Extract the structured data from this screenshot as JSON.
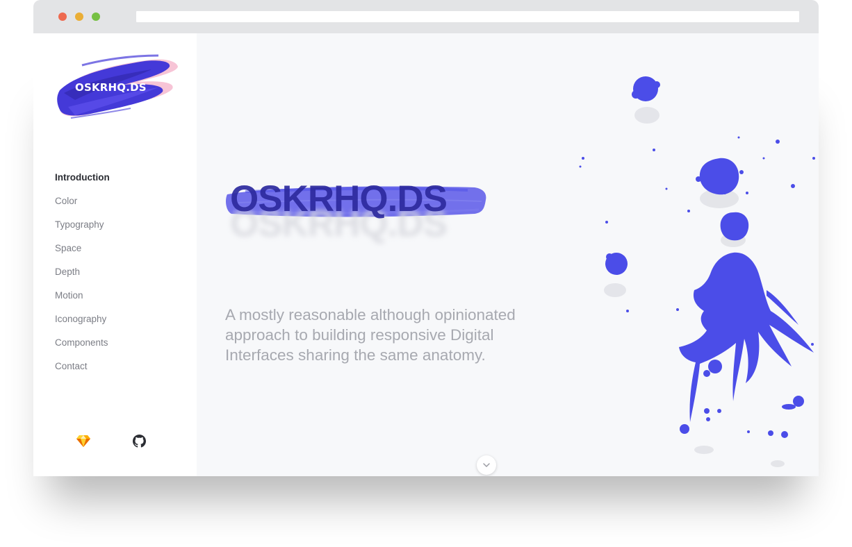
{
  "window": {
    "traffic_lights": [
      "close",
      "minimize",
      "zoom"
    ],
    "colors": {
      "close": "#ee6a50",
      "minimize": "#eaae36",
      "zoom": "#76c043"
    }
  },
  "sidebar": {
    "logo_text": "OSKRHQ.DS",
    "nav_items": [
      {
        "label": "Introduction",
        "active": true
      },
      {
        "label": "Color",
        "active": false
      },
      {
        "label": "Typography",
        "active": false
      },
      {
        "label": "Space",
        "active": false
      },
      {
        "label": "Depth",
        "active": false
      },
      {
        "label": "Motion",
        "active": false
      },
      {
        "label": "Iconography",
        "active": false
      },
      {
        "label": "Components",
        "active": false
      },
      {
        "label": "Contact",
        "active": false
      }
    ],
    "social_icons": [
      "sketch-icon",
      "github-icon"
    ]
  },
  "main": {
    "hero_title": "OSKRHQ.DS",
    "tagline": "A mostly reasonable although opinionated approach to building responsive Digital Interfaces sharing the same anatomy.",
    "scroll_icon": "chevron-down-icon"
  },
  "colors": {
    "accent": "#4b4de8",
    "brand_dark": "#2d2a9e",
    "brand_pink": "#f4a7c2",
    "text_active": "#2b2d33",
    "text_muted": "#7b7d85",
    "tagline": "#a7a9b0"
  }
}
